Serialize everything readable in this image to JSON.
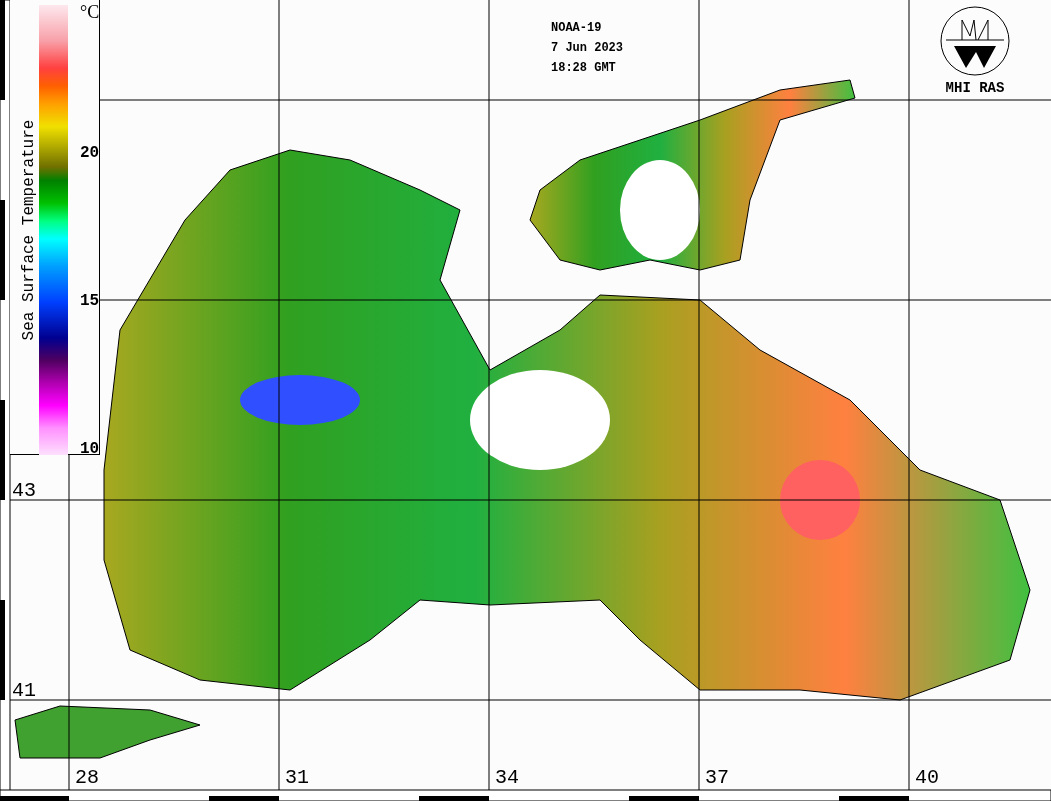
{
  "header": {
    "lines": [
      "NOAA-19",
      "7 Jun 2023",
      "18:28 GMT"
    ]
  },
  "logo": {
    "text": "MHI RAS"
  },
  "colorbar": {
    "title": "Sea Surface Temperature",
    "unit": "°C",
    "ticks": [
      "20",
      "15",
      "10"
    ]
  },
  "latitudes": [
    "43",
    "41"
  ],
  "longitudes": [
    "28",
    "31",
    "34",
    "37",
    "40"
  ]
}
